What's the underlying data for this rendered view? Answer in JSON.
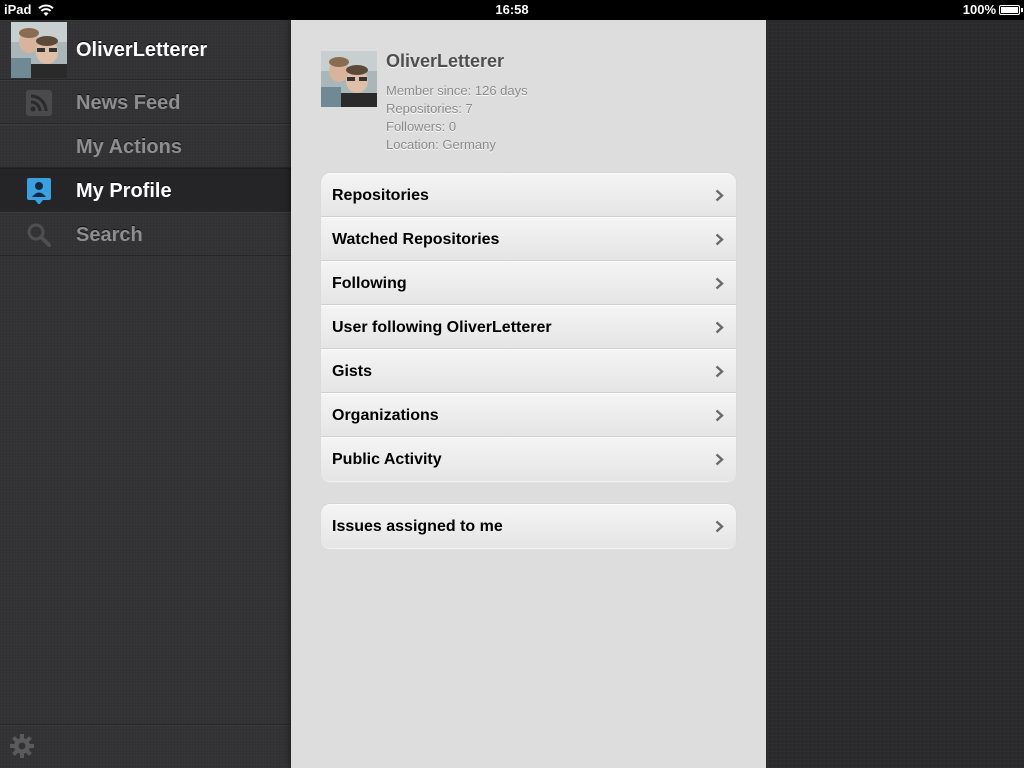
{
  "statusbar": {
    "device": "iPad",
    "time": "16:58",
    "battery": "100%"
  },
  "sidebar": {
    "account_name": "OliverLetterer",
    "items": [
      {
        "label": "News Feed",
        "icon": "rss-icon"
      },
      {
        "label": "My Actions",
        "icon": ""
      },
      {
        "label": "My Profile",
        "icon": "profile-icon",
        "selected": true
      },
      {
        "label": "Search",
        "icon": "search-icon"
      }
    ],
    "footer_icon": "gear-icon"
  },
  "profile": {
    "username": "OliverLetterer",
    "member_since": "Member since: 126 days",
    "repositories": "Repositories: 7",
    "followers": "Followers: 0",
    "location": "Location: Germany"
  },
  "groups": [
    {
      "rows": [
        {
          "label": "Repositories"
        },
        {
          "label": "Watched Repositories"
        },
        {
          "label": "Following"
        },
        {
          "label": "User following OliverLetterer"
        },
        {
          "label": "Gists"
        },
        {
          "label": "Organizations"
        },
        {
          "label": "Public Activity"
        }
      ]
    },
    {
      "rows": [
        {
          "label": "Issues assigned to me"
        }
      ]
    }
  ],
  "colors": {
    "sidebar_bg": "#333336",
    "content_bg": "#dddddd",
    "selected_bg": "#252527"
  }
}
